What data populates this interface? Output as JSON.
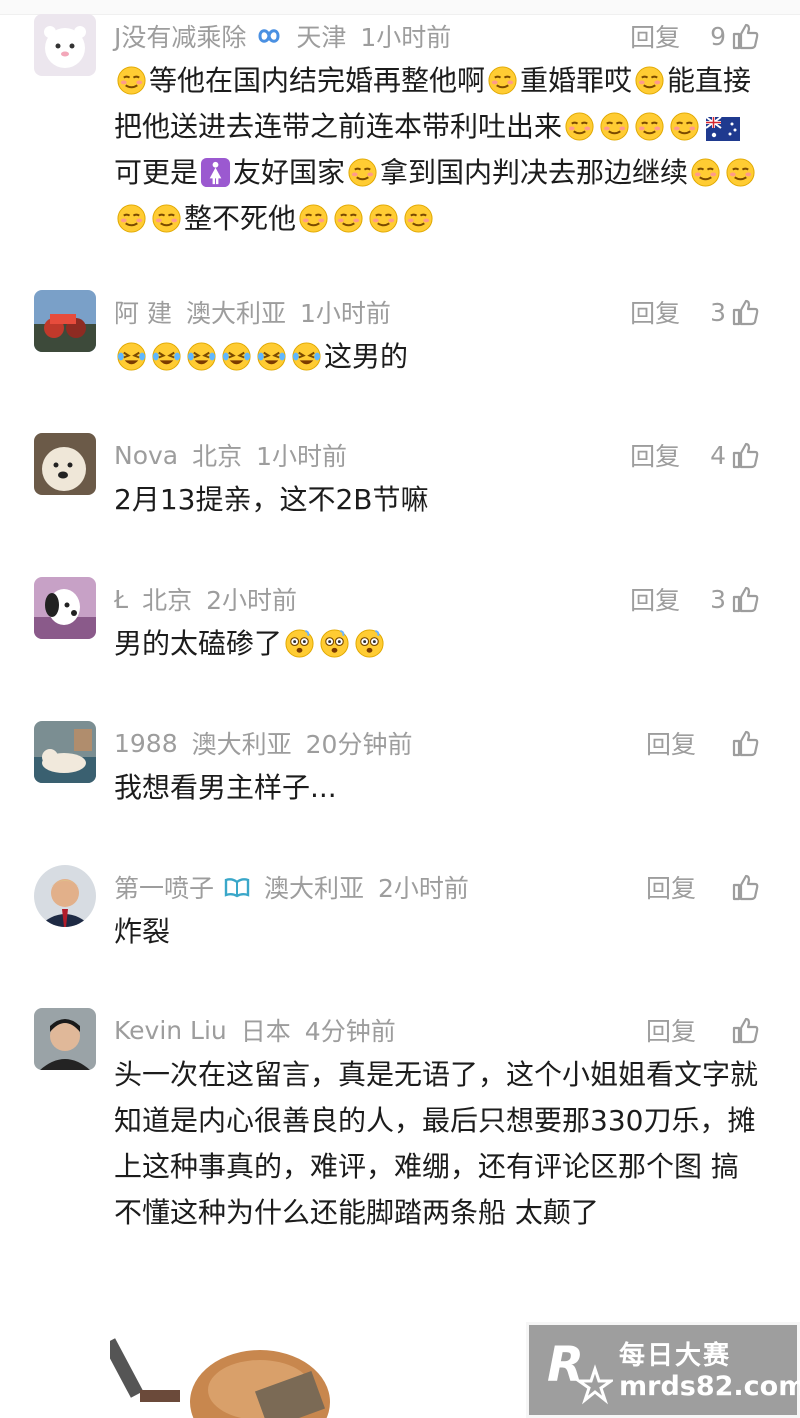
{
  "comments": [
    {
      "name": "J没有减乘除",
      "location": "天津",
      "time": "1小时前",
      "reply_label": "回复",
      "likes": "9",
      "badge": "infinity-badge",
      "segments": [
        {
          "e": "sly-face"
        },
        {
          "t": "等他在国内结完婚再整他啊"
        },
        {
          "e": "sly-face"
        },
        {
          "t": "重婚罪哎"
        },
        {
          "e": "sly-face"
        },
        {
          "t": "能直接把他送进去连带之前连本带利吐出来"
        },
        {
          "e": "sly-face"
        },
        {
          "e": "sly-face"
        },
        {
          "e": "sly-face"
        },
        {
          "e": "sly-face"
        },
        {
          "e": "australia-flag"
        },
        {
          "t": "可更是"
        },
        {
          "e": "female-sign"
        },
        {
          "t": "友好国家"
        },
        {
          "e": "sly-face"
        },
        {
          "t": "拿到国内判决去那边继续"
        },
        {
          "e": "sly-face"
        },
        {
          "e": "sly-face"
        },
        {
          "e": "sly-face"
        },
        {
          "e": "sly-face"
        },
        {
          "t": "整不死他"
        },
        {
          "e": "sly-face"
        },
        {
          "e": "sly-face"
        },
        {
          "e": "sly-face"
        },
        {
          "e": "sly-face"
        }
      ]
    },
    {
      "name": "阿 建",
      "location": "澳大利亚",
      "time": "1小时前",
      "reply_label": "回复",
      "likes": "3",
      "segments": [
        {
          "e": "crying-laugh-face"
        },
        {
          "e": "crying-laugh-face"
        },
        {
          "e": "crying-laugh-face"
        },
        {
          "e": "crying-laugh-face"
        },
        {
          "e": "crying-laugh-face"
        },
        {
          "e": "crying-laugh-face"
        },
        {
          "t": "这男的"
        }
      ]
    },
    {
      "name": "Nova",
      "location": "北京",
      "time": "1小时前",
      "reply_label": "回复",
      "likes": "4",
      "segments": [
        {
          "t": "2月13提亲，这不2B节嘛"
        }
      ]
    },
    {
      "name": "Ł",
      "location": "北京",
      "time": "2小时前",
      "reply_label": "回复",
      "likes": "3",
      "segments": [
        {
          "t": "男的太磕碜了"
        },
        {
          "e": "dizzy-face"
        },
        {
          "e": "dizzy-face"
        },
        {
          "e": "dizzy-face"
        }
      ]
    },
    {
      "name": "1988",
      "location": "澳大利亚",
      "time": "20分钟前",
      "reply_label": "回复",
      "likes": "",
      "segments": [
        {
          "t": "我想看男主样子..."
        }
      ]
    },
    {
      "name": "第一喷子",
      "location": "澳大利亚",
      "time": "2小时前",
      "reply_label": "回复",
      "likes": "",
      "badge": "book-badge",
      "segments": [
        {
          "t": "炸裂"
        }
      ]
    },
    {
      "name": "Kevin Liu",
      "location": "日本",
      "time": "4分钟前",
      "reply_label": "回复",
      "likes": "",
      "segments": [
        {
          "t": "头一次在这留言，真是无语了，这个小姐姐看文字就知道是内心很善良的人，最后只想要那330刀乐，摊上这种事真的，难评，难绷，还有评论区那个图 搞不懂这种为什么还能脚踏两条船 太颠了"
        }
      ]
    }
  ],
  "watermark": {
    "line1": "每日大赛",
    "line2": "mrds82.com"
  }
}
